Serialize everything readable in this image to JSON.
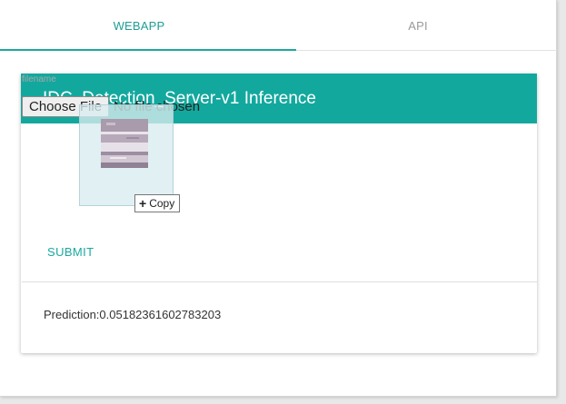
{
  "tabs": [
    {
      "label": "WEBAPP",
      "active": true
    },
    {
      "label": "API",
      "active": false
    }
  ],
  "card": {
    "title": "IDC_Detection_Server-v1 Inference",
    "field_label": "filename",
    "file_button_label": "Choose File",
    "file_status": "No file chosen",
    "submit_label": "SUBMIT",
    "prediction_text": "Prediction:0.05182361602783203"
  },
  "drag": {
    "tooltip_icon": "+",
    "tooltip_label": "Copy"
  },
  "colors": {
    "accent": "#13a89e",
    "header_text": "#ffffff",
    "inactive_tab": "#9a9a9a"
  }
}
